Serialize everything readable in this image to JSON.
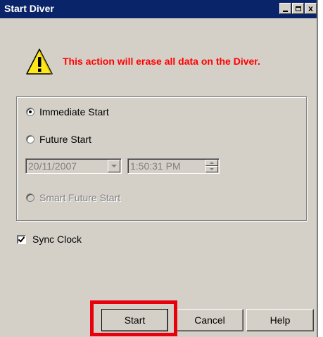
{
  "window": {
    "title": "Start Diver",
    "controls": {
      "minimize": "_",
      "maximize": "□",
      "close": "x"
    }
  },
  "warning": {
    "icon": "warning-icon",
    "message": "This action will erase all data on the Diver.",
    "color": "#ff0000"
  },
  "start_options": {
    "immediate_label": "Immediate Start",
    "future_label": "Future Start",
    "smart_future_label": "Smart Future Start",
    "selected": "Immediate Start",
    "date_value": "20/11/2007",
    "time_value": "1:50:31 PM"
  },
  "sync_clock": {
    "label": "Sync Clock",
    "checked": true
  },
  "buttons": {
    "start": "Start",
    "cancel": "Cancel",
    "help": "Help"
  },
  "highlight_color": "#e8000c",
  "title_bar_color": "#0a246a"
}
